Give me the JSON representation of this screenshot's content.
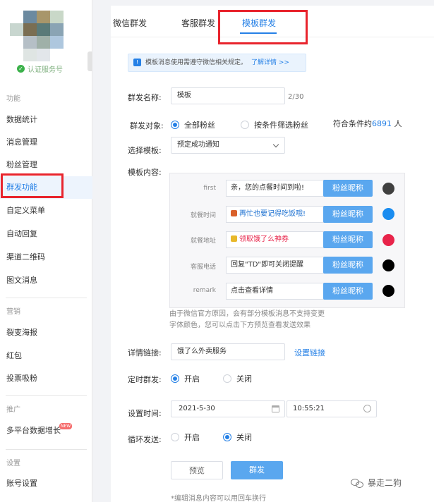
{
  "sidebar": {
    "verified": "认证服务号",
    "groups": {
      "function": "功能",
      "marketing": "营销",
      "promotion": "推广",
      "settings": "设置"
    },
    "items": [
      {
        "label": "数据统计"
      },
      {
        "label": "消息管理"
      },
      {
        "label": "粉丝管理"
      },
      {
        "label": "群发功能"
      },
      {
        "label": "自定义菜单"
      },
      {
        "label": "自动回复"
      },
      {
        "label": "渠道二维码"
      },
      {
        "label": "图文消息"
      },
      {
        "label": "裂变海报"
      },
      {
        "label": "红包"
      },
      {
        "label": "投票吸粉"
      },
      {
        "label": "多平台数据增长"
      },
      {
        "label": "账号设置"
      }
    ],
    "new_badge": "NEW"
  },
  "tabs": [
    {
      "label": "微信群发"
    },
    {
      "label": "客服群发"
    },
    {
      "label": "模板群发"
    }
  ],
  "notice": {
    "text": "模板消息使用需遵守微信相关规定。",
    "link": "了解详情 >>"
  },
  "form": {
    "name_label": "群发名称:",
    "name_value": "模板",
    "name_counter": "2/30",
    "target_label": "群发对象:",
    "target_all": "全部粉丝",
    "target_filter": "按条件筛选粉丝",
    "count_prefix": "符合条件约",
    "count_value": "6891",
    "count_suffix": " 人",
    "template_label": "选择模板:",
    "template_value": "预定成功通知",
    "content_label": "模板内容:",
    "fields": [
      {
        "key": "first",
        "value": "亲，您的点餐时间到啦!",
        "button": "粉丝昵称",
        "color": "#404040"
      },
      {
        "key": "就餐时间",
        "value": "再忙也要记得吃饭哦!",
        "button": "粉丝昵称",
        "color": "#1a8cf0"
      },
      {
        "key": "就餐地址",
        "value": "领取饿了么神券",
        "button": "粉丝昵称",
        "color": "#e8244a"
      },
      {
        "key": "客服电话",
        "value": "回复\"TD\"即可关闭提醒",
        "button": "粉丝昵称",
        "color": "#000000"
      },
      {
        "key": "remark",
        "value": "点击查看详情",
        "button": "粉丝昵称",
        "color": "#000000"
      }
    ],
    "content_hint_1": "由于微信官方原因，会有部分模板消息不支持变更",
    "content_hint_2": "字体颜色，您可以点击下方预览查看发送效果",
    "link_label": "详情链接:",
    "link_value": "饿了么外卖服务",
    "link_action": "设置链接",
    "schedule_label": "定时群发:",
    "schedule_on": "开启",
    "schedule_off": "关闭",
    "time_label": "设置时间:",
    "date_value": "2021-5-30",
    "time_value": "10:55:21",
    "loop_label": "循环发送:",
    "loop_on": "开启",
    "loop_off": "关闭",
    "preview_button": "预览",
    "send_button": "群发",
    "footer_hint": "*编辑消息内容可以用回车换行"
  },
  "watermark": "暴走二狗",
  "colors": {
    "accent": "#2580e6",
    "highlight_box": "#e8242d",
    "button": "#5aa7ef"
  }
}
